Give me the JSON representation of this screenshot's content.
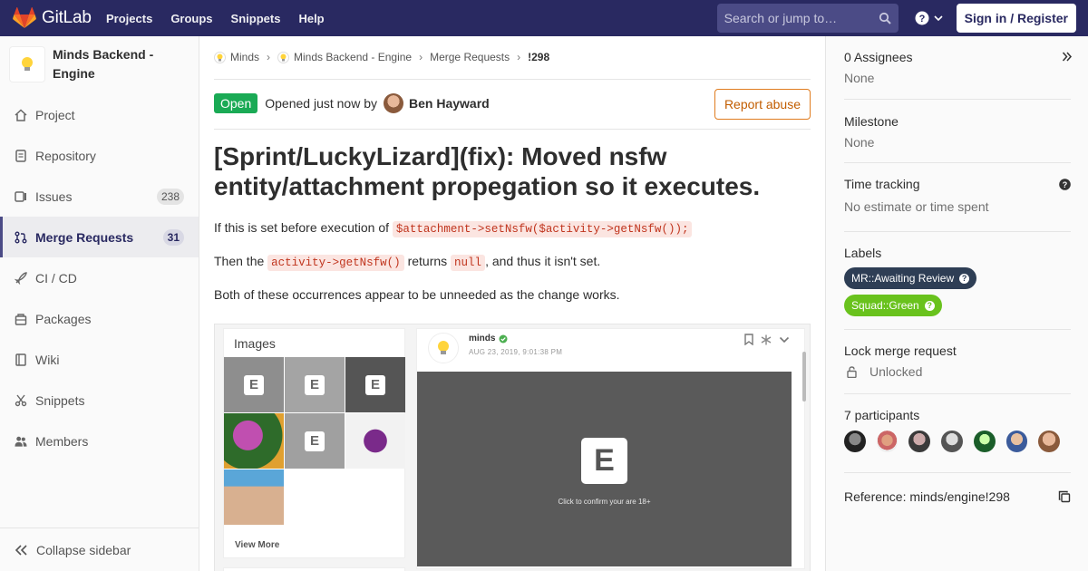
{
  "navbar": {
    "brand": "GitLab",
    "links": [
      "Projects",
      "Groups",
      "Snippets",
      "Help"
    ],
    "search_placeholder": "Search or jump to…",
    "sign_in": "Sign in / Register"
  },
  "sidebar": {
    "project_name": "Minds Backend - Engine",
    "items": [
      {
        "label": "Project",
        "icon": "home-icon"
      },
      {
        "label": "Repository",
        "icon": "doc-icon"
      },
      {
        "label": "Issues",
        "icon": "issues-icon",
        "count": "238"
      },
      {
        "label": "Merge Requests",
        "icon": "merge-request-icon",
        "count": "31"
      },
      {
        "label": "CI / CD",
        "icon": "rocket-icon"
      },
      {
        "label": "Packages",
        "icon": "package-icon"
      },
      {
        "label": "Wiki",
        "icon": "book-icon"
      },
      {
        "label": "Snippets",
        "icon": "scissors-icon"
      },
      {
        "label": "Members",
        "icon": "users-icon"
      }
    ],
    "collapse": "Collapse sidebar"
  },
  "breadcrumb": [
    "Minds",
    "Minds Backend - Engine",
    "Merge Requests",
    "!298"
  ],
  "mr": {
    "status": "Open",
    "opened_text": "Opened just now by",
    "author": "Ben Hayward",
    "report_abuse": "Report abuse",
    "title": "[Sprint/LuckyLizard](fix): Moved nsfw entity/attachment propegation so it executes.",
    "p1_text": "If this is set before execution of ",
    "p1_code": "$attachment->setNsfw($activity->getNsfw());",
    "p2_pre": "Then the ",
    "p2_code1": "activity->getNsfw()",
    "p2_mid": " returns ",
    "p2_code2": "null",
    "p2_post": ", and thus it isn't set.",
    "p3": "Both of these occurrences appear to be unneeded as the change works."
  },
  "embed": {
    "images_label": "Images",
    "thumb_letter": "E",
    "view_more": "View More",
    "post_user": "minds",
    "post_date": "AUG 23, 2019, 9:01:38 PM",
    "nsfw_letter": "E",
    "nsfw_cta": "Click to confirm your are 18+"
  },
  "right_sidebar": {
    "assignees_title": "0 Assignees",
    "assignees_value": "None",
    "milestone_title": "Milestone",
    "milestone_value": "None",
    "time_title": "Time tracking",
    "time_value": "No estimate or time spent",
    "labels_title": "Labels",
    "labels": [
      {
        "text": "MR::Awaiting Review",
        "color": "#2e3e55"
      },
      {
        "text": "Squad::Green",
        "color": "#69c21d"
      }
    ],
    "lock_title": "Lock merge request",
    "lock_value": "Unlocked",
    "participants_title": "7 participants",
    "reference": "Reference: minds/engine!298"
  }
}
